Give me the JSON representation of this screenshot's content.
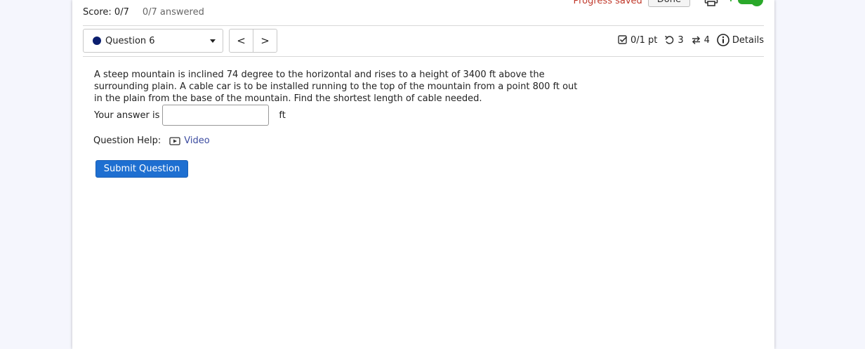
{
  "header": {
    "progress_status": "Progress saved",
    "done_label": "Done",
    "score": "Score: 0/7",
    "answered": "0/7 answered"
  },
  "question_nav": {
    "selected_question": "Question 6",
    "prev_label": "<",
    "next_label": ">"
  },
  "meta": {
    "points": "0/1 pt",
    "retries": "3",
    "attempts": "4",
    "details_label": "Details"
  },
  "question": {
    "text": "A steep mountain is inclined 74 degree to the horizontal and rises to a height of 3400 ft above the surrounding plain. A cable car is to be installed running to the top of the mountain from a point 800 ft out in the plain from the base of the mountain. Find the shortest length of cable needed.",
    "answer_prompt": "Your answer is",
    "answer_value": "",
    "unit": "ft"
  },
  "help": {
    "label": "Question Help:",
    "video_label": "Video"
  },
  "submit_label": "Submit Question",
  "colors": {
    "accent": "#1e6fd1",
    "progress_text": "#c0392b",
    "question_dot": "#0b1e6e",
    "toggle_on": "#2aa82a"
  }
}
